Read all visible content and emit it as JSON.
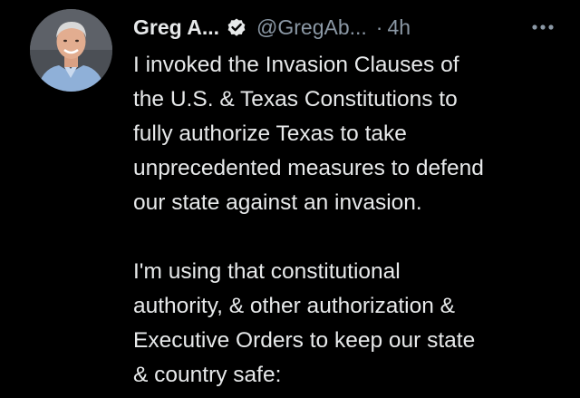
{
  "tweet": {
    "author": {
      "display_name": "Greg A...",
      "handle": "@GregAb...",
      "verified": true,
      "avatar_icon": "profile-photo"
    },
    "separator": "·",
    "timestamp": "4h",
    "more_icon": "more-horizontal-icon",
    "paragraphs": [
      [
        "I invoked the Invasion Clauses of",
        "the U.S. & Texas Constitutions to",
        "fully authorize Texas to take",
        "unprecedented measures to defend",
        "our state against an invasion."
      ],
      [
        "I'm using that constitutional",
        "authority, & other authorization &",
        "Executive Orders to keep our state",
        "& country safe:"
      ]
    ]
  },
  "colors": {
    "background": "#000000",
    "text_primary": "#e7e9ea",
    "text_secondary": "#8b98a5",
    "verified_badge": "#e7e9ea"
  }
}
